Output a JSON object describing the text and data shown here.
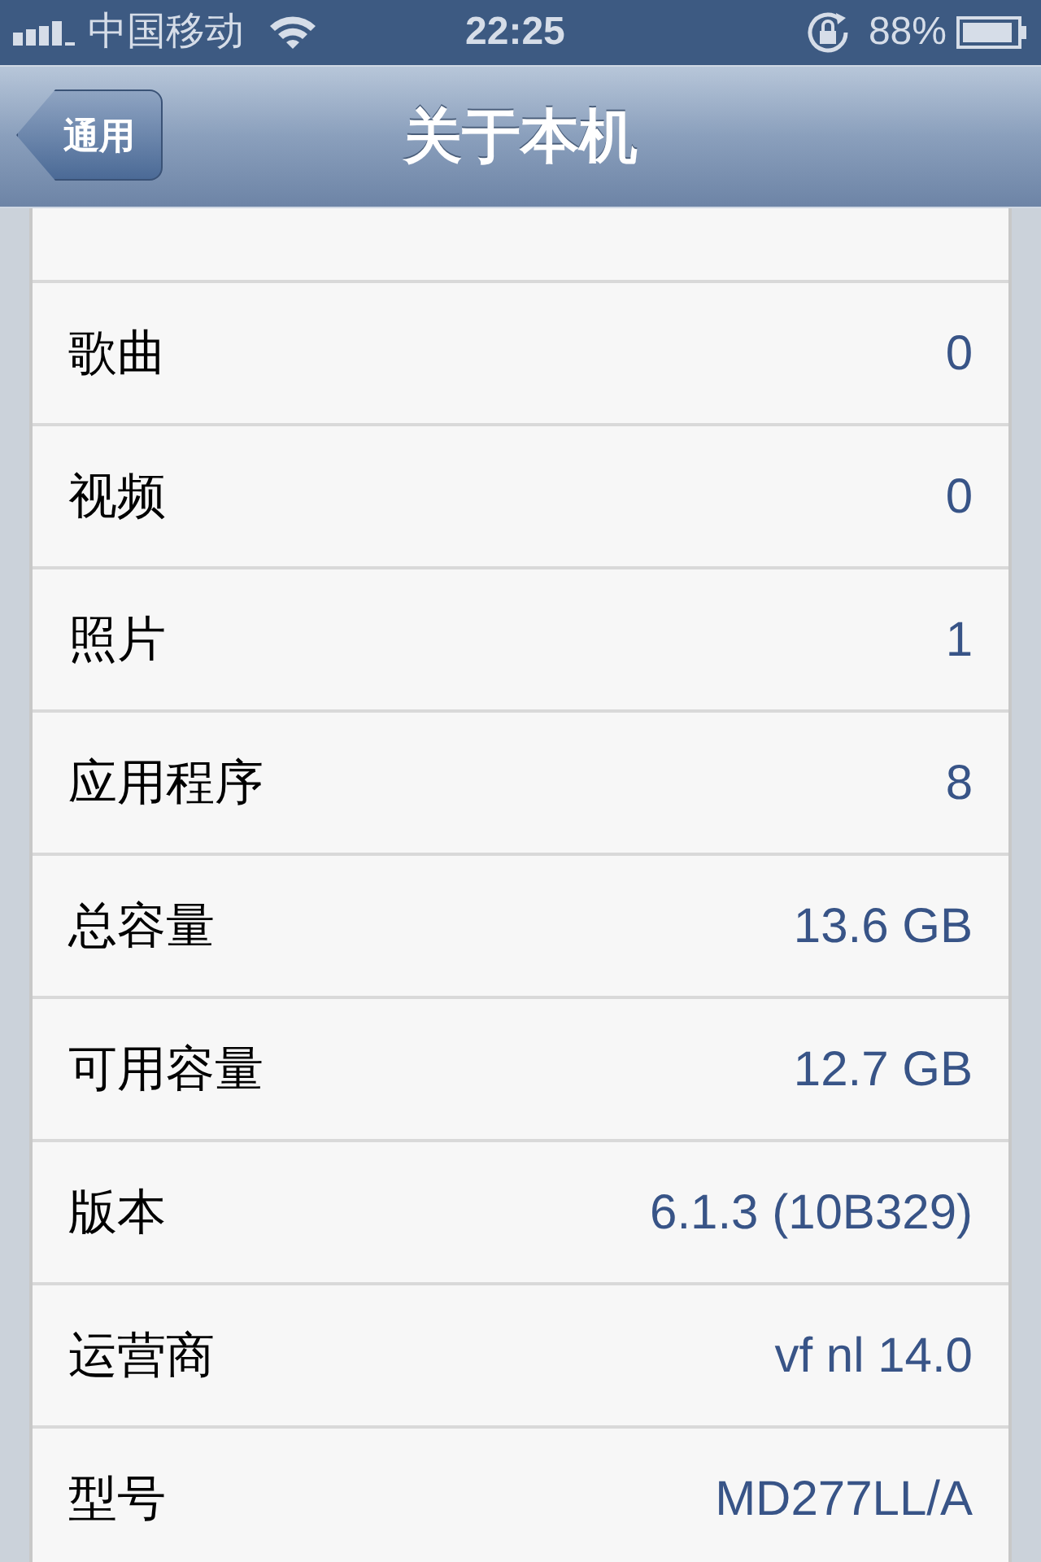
{
  "status_bar": {
    "carrier": "中国移动",
    "time": "22:25",
    "battery": "88%"
  },
  "nav_bar": {
    "back": "通用",
    "title": "关于本机"
  },
  "rows": [
    {
      "label": "歌曲",
      "value": "0"
    },
    {
      "label": "视频",
      "value": "0"
    },
    {
      "label": "照片",
      "value": "1"
    },
    {
      "label": "应用程序",
      "value": "8"
    },
    {
      "label": "总容量",
      "value": "13.6 GB"
    },
    {
      "label": "可用容量",
      "value": "12.7 GB"
    },
    {
      "label": "版本",
      "value": "6.1.3 (10B329)"
    },
    {
      "label": "运营商",
      "value": "vf nl 14.0"
    },
    {
      "label": "型号",
      "value": "MD277LL/A"
    }
  ]
}
